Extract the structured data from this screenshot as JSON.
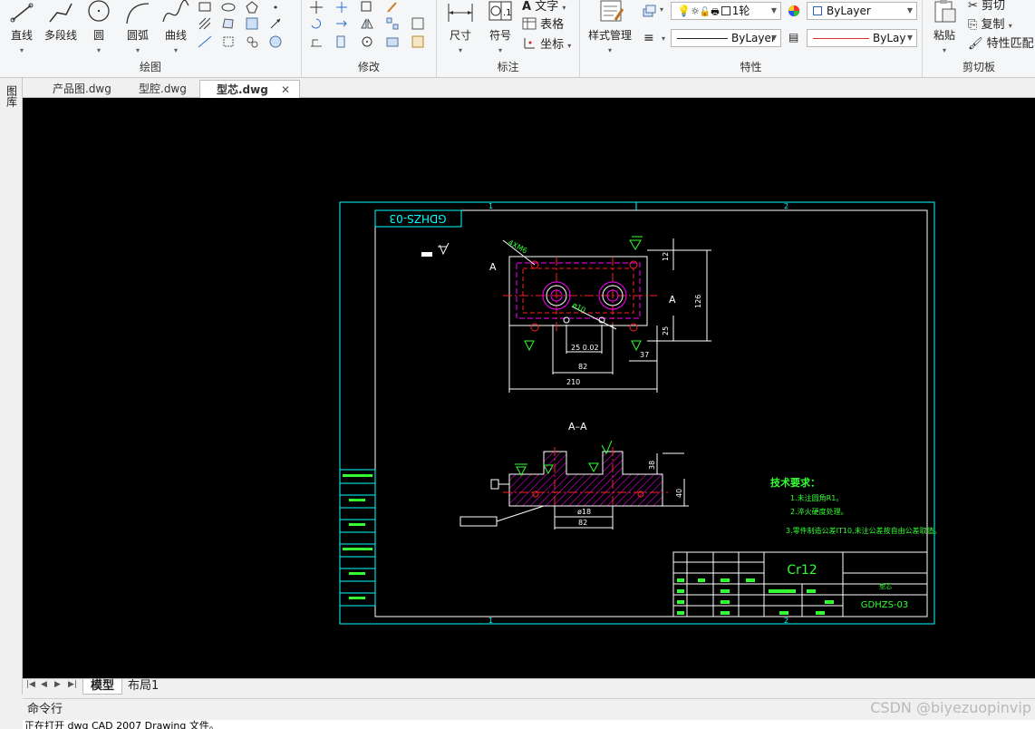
{
  "ribbon": {
    "draw_group": {
      "label": "绘图",
      "line": "直线",
      "polyline": "多段线",
      "circle": "圆",
      "arc": "圆弧",
      "curve": "曲线"
    },
    "modify_group": {
      "label": "修改"
    },
    "annotate_group": {
      "label": "标注",
      "dimension": "尺寸",
      "symbol": "符号",
      "text": "文字",
      "table": "表格",
      "coordinate": "坐标"
    },
    "properties_group": {
      "label": "特性",
      "style_manager": "样式管理",
      "layer_value": "1轮",
      "color_value": "ByLayer",
      "linetype_value": "ByLayer",
      "lineweight_value": "ByLay",
      "colors": {
        "layer_swatch": "#ffffff",
        "lineweight_line": "#e03030",
        "color_square": "#2a5db0"
      }
    },
    "clipboard_group": {
      "label": "剪切板",
      "paste": "粘贴",
      "cut": "剪切",
      "copy": "复制",
      "match_properties": "特性匹配"
    }
  },
  "tabs": [
    {
      "label": "产品图.dwg",
      "active": false
    },
    {
      "label": "型腔.dwg",
      "active": false
    },
    {
      "label": "型芯.dwg",
      "active": true
    }
  ],
  "left_strip": {
    "label": "图库"
  },
  "layout_tabs": [
    {
      "label": "模型",
      "active": true
    },
    {
      "label": "布局1",
      "active": false
    }
  ],
  "command": {
    "label": "命令行",
    "line": "正在打开 dwg CAD 2007 Drawing 文件。"
  },
  "watermark": "CSDN @biyezuopinvip",
  "drawing": {
    "drawing_no": "GDHZS-03",
    "material": "Cr12",
    "part_name": "型芯",
    "title_block_no": "GDHZS-03",
    "section_label": "A–A",
    "view_marker": "A",
    "tech_title": "技术要求：",
    "tech_lines": [
      "1.未注圆角R1。",
      "2.淬火硬度处理。",
      "3.零件制造公差IT10,未注公差按自由公差取值。"
    ],
    "dims": {
      "d_4xm6": "4XM6",
      "d_12": "12",
      "d_126": "126",
      "d_25": "25",
      "d_37": "37",
      "d_82": "82",
      "d_25tol": "25 0.02",
      "d_210": "210",
      "d_10": "ø10",
      "d_38": "38",
      "d_40": "40",
      "d_18": "ø18",
      "d_82b": "82"
    },
    "zone_top_1": "1",
    "zone_top_2": "2",
    "zone_bot_1": "1",
    "zone_bot_2": "2",
    "colors": {
      "frame": "#00ffff",
      "border": "#ffffff",
      "outline": "#ff00ff",
      "hidden": "#ff2020",
      "dim": "#ffffff",
      "text": "#33ff33",
      "hatch": "#ff00ff"
    }
  }
}
